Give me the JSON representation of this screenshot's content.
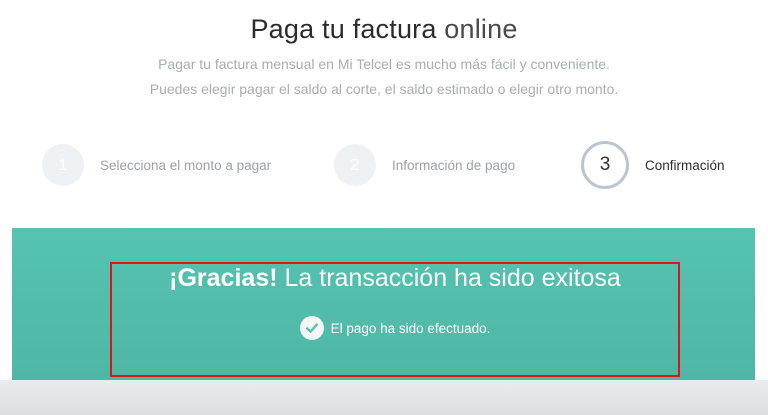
{
  "header": {
    "title_bold": "Paga tu factura",
    "title_light": "online",
    "subtitle_line1": "Pagar tu factura mensual en Mi Telcel es mucho más fácil y conveniente.",
    "subtitle_line2": "Puedes elegir pagar el saldo al corte, el saldo estimado o elegir otro monto."
  },
  "steps": [
    {
      "number": "1",
      "label": "Selecciona el monto a pagar",
      "state": "inactive"
    },
    {
      "number": "2",
      "label": "Información de pago",
      "state": "inactive"
    },
    {
      "number": "3",
      "label": "Confirmación",
      "state": "active"
    }
  ],
  "confirmation": {
    "thanks_bold": "¡Gracias!",
    "thanks_text": "La transacción ha sido exitosa",
    "status_text": "El pago ha sido efectuado.",
    "icon": "check-circle-icon"
  },
  "colors": {
    "banner": "#56c3b1",
    "highlight_border": "#e0131b",
    "active_step_border": "#b9c6d1"
  }
}
